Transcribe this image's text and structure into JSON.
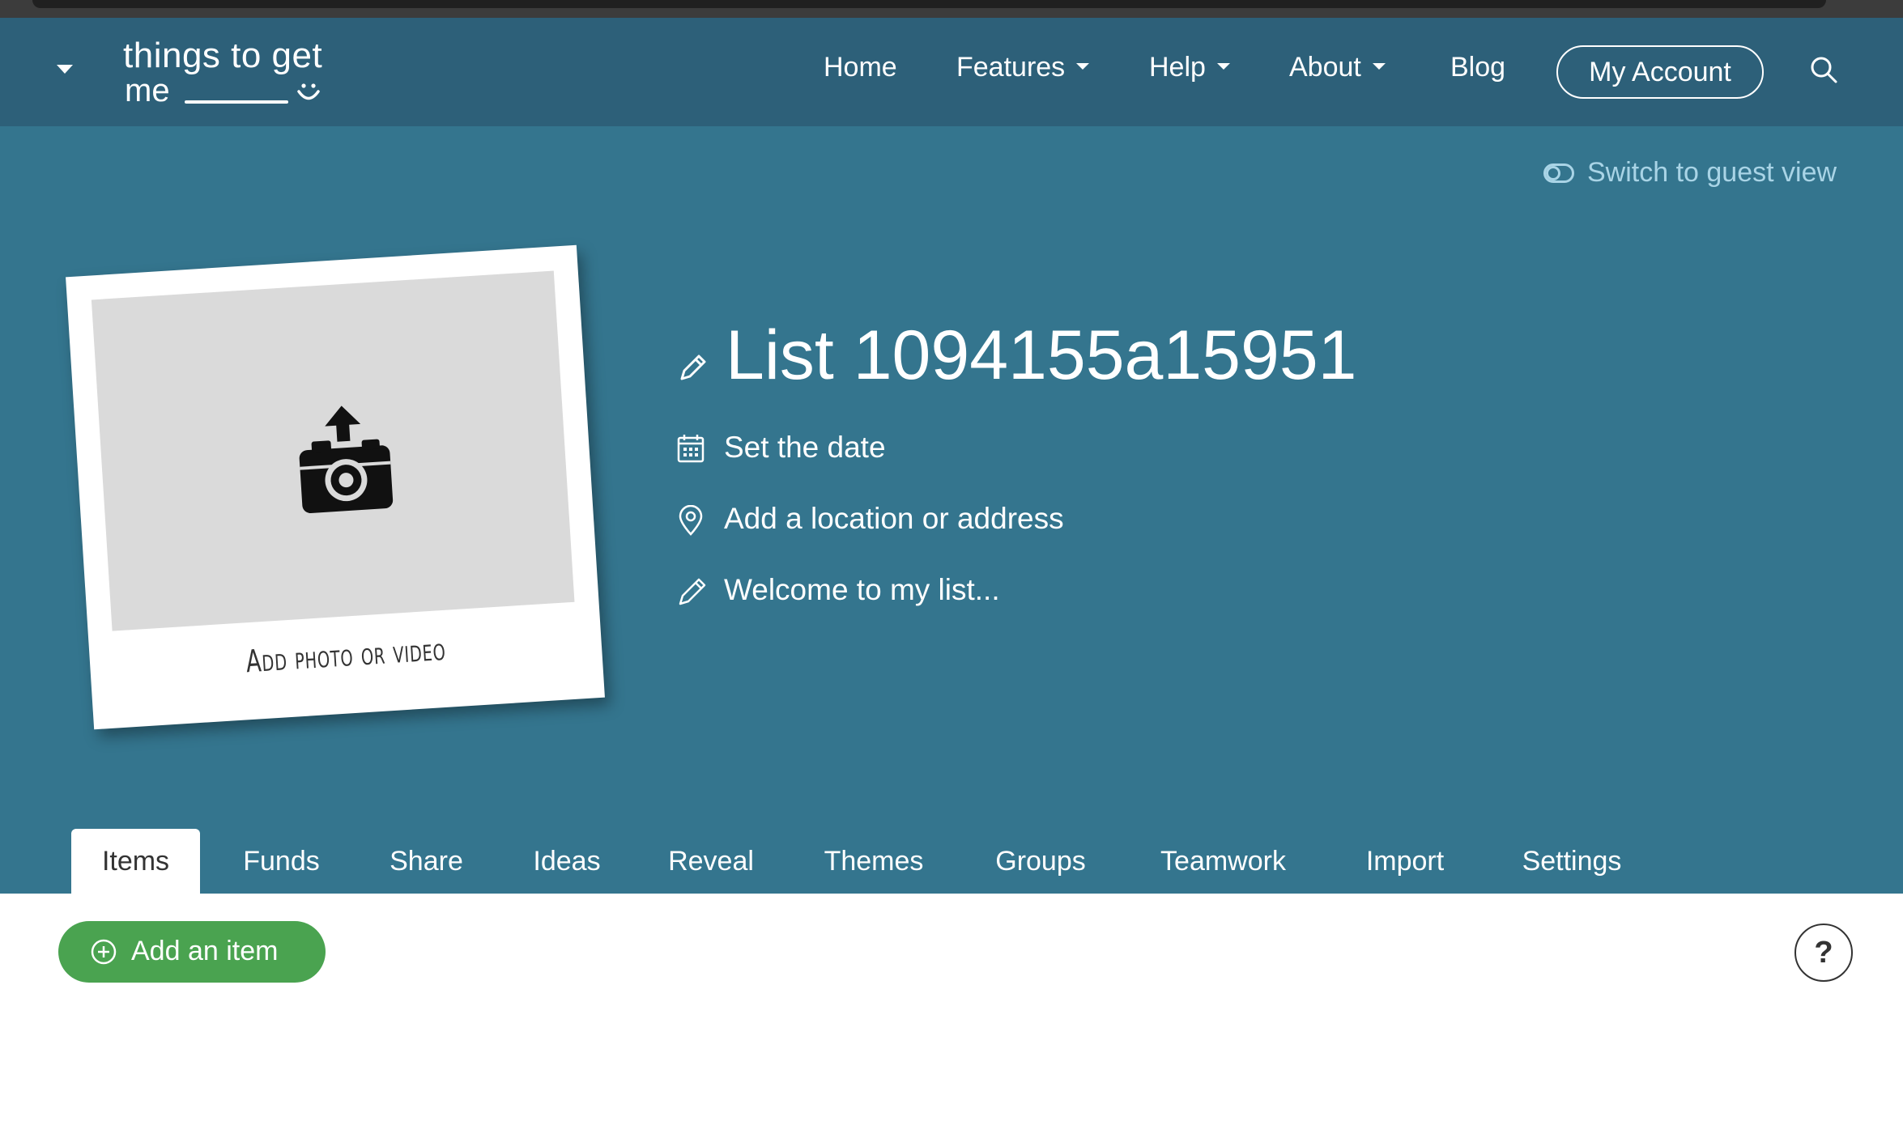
{
  "logo": {
    "line1": "things to get",
    "line2": "me"
  },
  "nav": {
    "items": [
      {
        "label": "Home"
      },
      {
        "label": "Features"
      },
      {
        "label": "Help"
      },
      {
        "label": "About"
      },
      {
        "label": "Blog"
      }
    ],
    "account_label": "My Account"
  },
  "hero": {
    "guest_view_label": "Switch to guest view",
    "photo_caption": "Add photo or video",
    "title": "List 1094155a15951",
    "date_label": "Set the date",
    "location_label": "Add a location or address",
    "welcome_label": "Welcome to my list..."
  },
  "tabs": [
    {
      "label": "Items",
      "active": true
    },
    {
      "label": "Funds"
    },
    {
      "label": "Share"
    },
    {
      "label": "Ideas"
    },
    {
      "label": "Reveal"
    },
    {
      "label": "Themes"
    },
    {
      "label": "Groups"
    },
    {
      "label": "Teamwork"
    },
    {
      "label": "Import"
    },
    {
      "label": "Settings"
    }
  ],
  "main": {
    "add_item_label": "Add an item",
    "help_label": "?"
  },
  "colors": {
    "navbar": "#2d6079",
    "hero": "#34758e",
    "accent_green": "#4aa350",
    "guest_view_text": "#a9d4e6"
  }
}
